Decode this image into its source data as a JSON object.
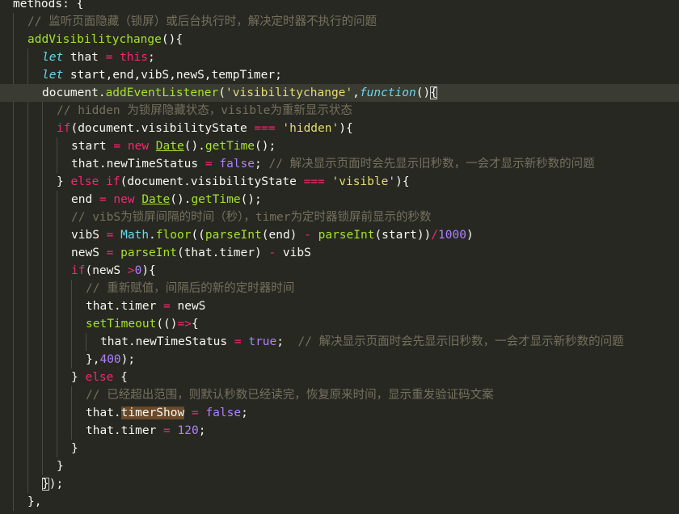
{
  "editor": {
    "theme": "monokai",
    "colors": {
      "background": "#272822",
      "current_line": "#3a3b33",
      "comment": "#75715e",
      "keyword": "#f92672",
      "function": "#a6e22e",
      "string": "#e6db74",
      "number": "#ae81ff",
      "storage": "#66d9ef",
      "text": "#f8f8f2"
    },
    "current_line_index": 5,
    "lines": [
      {
        "indent": 0,
        "tokens": [
          [
            "plain",
            "methods: {"
          ]
        ]
      },
      {
        "indent": 1,
        "tokens": [
          [
            "comment",
            "// 监听页面隐藏（锁屏）或后台执行时，解决定时器不执行的问题"
          ]
        ]
      },
      {
        "indent": 1,
        "tokens": [
          [
            "func",
            "addVisibilitychange"
          ],
          [
            "plain",
            "(){"
          ]
        ]
      },
      {
        "indent": 2,
        "tokens": [
          [
            "storage",
            "let"
          ],
          [
            "plain",
            " that "
          ],
          [
            "op",
            "="
          ],
          [
            "plain",
            " "
          ],
          [
            "this",
            "this"
          ],
          [
            "plain",
            ";"
          ]
        ]
      },
      {
        "indent": 2,
        "tokens": [
          [
            "storage",
            "let"
          ],
          [
            "plain",
            " start,end,vibS,newS,tempTimer;"
          ]
        ]
      },
      {
        "indent": 2,
        "tokens": [
          [
            "plain",
            "document."
          ],
          [
            "func",
            "addEventListener"
          ],
          [
            "plain",
            "("
          ],
          [
            "string",
            "'visibilitychange'"
          ],
          [
            "plain",
            ","
          ],
          [
            "fnkw",
            "function"
          ],
          [
            "plain",
            "()"
          ],
          [
            "bracket",
            "{"
          ]
        ]
      },
      {
        "indent": 3,
        "tokens": [
          [
            "comment",
            "// hidden 为锁屏隐藏状态，visible为重新显示状态"
          ]
        ]
      },
      {
        "indent": 3,
        "tokens": [
          [
            "keyword",
            "if"
          ],
          [
            "plain",
            "(document.visibilityState "
          ],
          [
            "op",
            "==="
          ],
          [
            "plain",
            " "
          ],
          [
            "string",
            "'hidden'"
          ],
          [
            "plain",
            "){"
          ]
        ]
      },
      {
        "indent": 4,
        "tokens": [
          [
            "plain",
            "start "
          ],
          [
            "op",
            "="
          ],
          [
            "plain",
            " "
          ],
          [
            "keyword",
            "new"
          ],
          [
            "plain",
            " "
          ],
          [
            "class",
            "Date"
          ],
          [
            "plain",
            "()."
          ],
          [
            "func",
            "getTime"
          ],
          [
            "plain",
            "();"
          ]
        ]
      },
      {
        "indent": 4,
        "tokens": [
          [
            "plain",
            "that.newTimeStatus "
          ],
          [
            "op",
            "="
          ],
          [
            "plain",
            " "
          ],
          [
            "const",
            "false"
          ],
          [
            "plain",
            "; "
          ],
          [
            "comment",
            "// 解决显示页面时会先显示旧秒数，一会才显示新秒数的问题"
          ]
        ]
      },
      {
        "indent": 3,
        "tokens": [
          [
            "plain",
            "} "
          ],
          [
            "keyword",
            "else"
          ],
          [
            "plain",
            " "
          ],
          [
            "keyword",
            "if"
          ],
          [
            "plain",
            "(document.visibilityState "
          ],
          [
            "op",
            "==="
          ],
          [
            "plain",
            " "
          ],
          [
            "string",
            "'visible'"
          ],
          [
            "plain",
            "){"
          ]
        ]
      },
      {
        "indent": 4,
        "tokens": [
          [
            "plain",
            "end "
          ],
          [
            "op",
            "="
          ],
          [
            "plain",
            " "
          ],
          [
            "keyword",
            "new"
          ],
          [
            "plain",
            " "
          ],
          [
            "class",
            "Date"
          ],
          [
            "plain",
            "()."
          ],
          [
            "func",
            "getTime"
          ],
          [
            "plain",
            "();"
          ]
        ]
      },
      {
        "indent": 4,
        "tokens": [
          [
            "comment",
            "// vibS为锁屏间隔的时间（秒），timer为定时器锁屏前显示的秒数"
          ]
        ]
      },
      {
        "indent": 4,
        "tokens": [
          [
            "plain",
            "vibS "
          ],
          [
            "op",
            "="
          ],
          [
            "plain",
            " "
          ],
          [
            "builtin",
            "Math"
          ],
          [
            "plain",
            "."
          ],
          [
            "func",
            "floor"
          ],
          [
            "plain",
            "(("
          ],
          [
            "func",
            "parseInt"
          ],
          [
            "plain",
            "(end) "
          ],
          [
            "op",
            "-"
          ],
          [
            "plain",
            " "
          ],
          [
            "func",
            "parseInt"
          ],
          [
            "plain",
            "(start))"
          ],
          [
            "op",
            "/"
          ],
          [
            "number",
            "1000"
          ],
          [
            "plain",
            ")"
          ]
        ]
      },
      {
        "indent": 4,
        "tokens": [
          [
            "plain",
            "newS "
          ],
          [
            "op",
            "="
          ],
          [
            "plain",
            " "
          ],
          [
            "func",
            "parseInt"
          ],
          [
            "plain",
            "(that.timer) "
          ],
          [
            "op",
            "-"
          ],
          [
            "plain",
            " vibS"
          ]
        ]
      },
      {
        "indent": 4,
        "tokens": [
          [
            "keyword",
            "if"
          ],
          [
            "plain",
            "(newS "
          ],
          [
            "op",
            ">"
          ],
          [
            "number",
            "0"
          ],
          [
            "plain",
            "){"
          ]
        ]
      },
      {
        "indent": 5,
        "tokens": [
          [
            "comment",
            "// 重新赋值，间隔后的新的定时器时间"
          ]
        ]
      },
      {
        "indent": 5,
        "tokens": [
          [
            "plain",
            "that.timer "
          ],
          [
            "op",
            "="
          ],
          [
            "plain",
            " newS"
          ]
        ]
      },
      {
        "indent": 5,
        "tokens": [
          [
            "func",
            "setTimeout"
          ],
          [
            "plain",
            "(()"
          ],
          [
            "op",
            "=>"
          ],
          [
            "plain",
            "{"
          ]
        ]
      },
      {
        "indent": 6,
        "tokens": [
          [
            "plain",
            "that.newTimeStatus "
          ],
          [
            "op",
            "="
          ],
          [
            "plain",
            " "
          ],
          [
            "const",
            "true"
          ],
          [
            "plain",
            ";  "
          ],
          [
            "comment",
            "// 解决显示页面时会先显示旧秒数，一会才显示新秒数的问题"
          ]
        ]
      },
      {
        "indent": 5,
        "tokens": [
          [
            "plain",
            "},"
          ],
          [
            "number",
            "400"
          ],
          [
            "plain",
            ");"
          ]
        ]
      },
      {
        "indent": 4,
        "tokens": [
          [
            "plain",
            "} "
          ],
          [
            "keyword",
            "else"
          ],
          [
            "plain",
            " {"
          ]
        ]
      },
      {
        "indent": 5,
        "tokens": [
          [
            "comment",
            "// 已经超出范围，则默认秒数已经读完，恢复原来时间，显示重发验证码文案"
          ]
        ]
      },
      {
        "indent": 5,
        "tokens": [
          [
            "plain",
            "that."
          ],
          [
            "highlight",
            "timerShow"
          ],
          [
            "plain",
            " "
          ],
          [
            "op",
            "="
          ],
          [
            "plain",
            " "
          ],
          [
            "const",
            "false"
          ],
          [
            "plain",
            ";"
          ]
        ]
      },
      {
        "indent": 5,
        "tokens": [
          [
            "plain",
            "that.timer "
          ],
          [
            "op",
            "="
          ],
          [
            "plain",
            " "
          ],
          [
            "number",
            "120"
          ],
          [
            "plain",
            ";"
          ]
        ]
      },
      {
        "indent": 4,
        "tokens": [
          [
            "plain",
            "}"
          ]
        ]
      },
      {
        "indent": 3,
        "tokens": [
          [
            "plain",
            "}"
          ]
        ]
      },
      {
        "indent": 2,
        "tokens": [
          [
            "bracket",
            "}"
          ],
          [
            "plain",
            ");"
          ]
        ]
      },
      {
        "indent": 1,
        "tokens": [
          [
            "plain",
            "},"
          ]
        ]
      }
    ]
  }
}
